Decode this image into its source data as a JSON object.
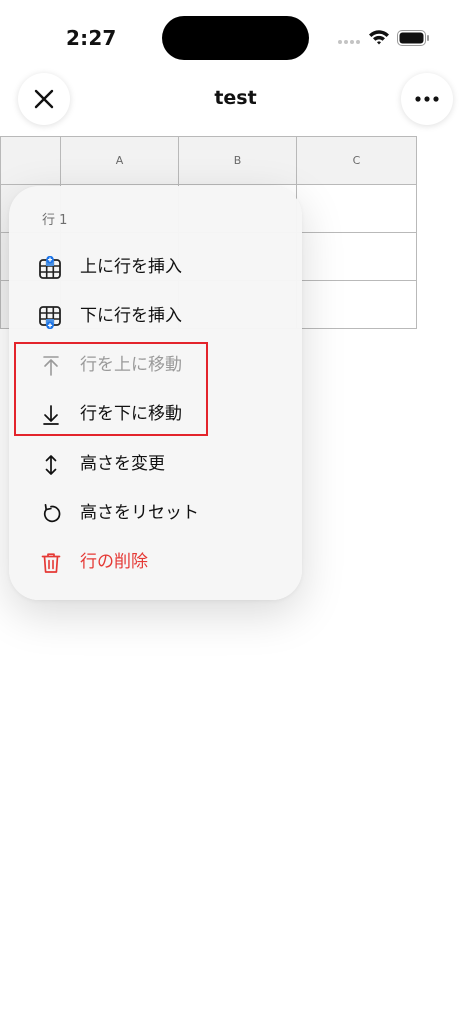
{
  "status_bar": {
    "time": "2:27"
  },
  "nav": {
    "title": "test"
  },
  "grid": {
    "columns": [
      "",
      "A",
      "B",
      "C"
    ]
  },
  "menu": {
    "header": "行 1",
    "items": [
      {
        "label": "上に行を挿入",
        "icon": "insert-row-above-icon"
      },
      {
        "label": "下に行を挿入",
        "icon": "insert-row-below-icon"
      },
      {
        "label": "行を上に移動",
        "icon": "arrow-up-icon",
        "disabled": true
      },
      {
        "label": "行を下に移動",
        "icon": "arrow-down-icon"
      },
      {
        "label": "高さを変更",
        "icon": "resize-vertical-icon"
      },
      {
        "label": "高さをリセット",
        "icon": "reset-icon"
      },
      {
        "label": "行の削除",
        "icon": "trash-icon",
        "destructive": true
      }
    ]
  },
  "colors": {
    "accent": "#1a73e8",
    "destructive": "#e53935",
    "highlight": "#e3242b"
  }
}
